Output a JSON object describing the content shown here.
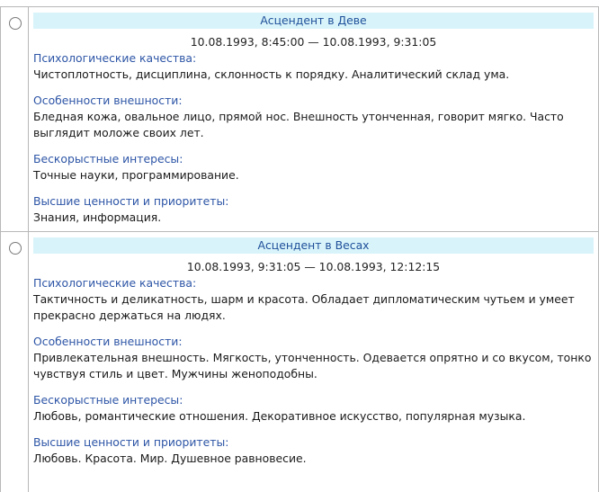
{
  "entries": [
    {
      "title": "Асцендент в Деве",
      "range": "10.08.1993, 8:45:00  —  10.08.1993, 9:31:05",
      "sections": [
        {
          "label": "Психологические качества:",
          "text": "Чистоплотность, дисциплина, склонность к порядку. Аналитический склад ума."
        },
        {
          "label": "Особенности внешности:",
          "text": "Бледная кожа, овальное лицо, прямой нос. Внешность утонченная, говорит мягко. Часто выглядит моложе своих лет."
        },
        {
          "label": "Бескорыстные интересы:",
          "text": "Точные науки, программирование."
        },
        {
          "label": "Высшие ценности и приоритеты:",
          "text": "Знания, информация."
        }
      ]
    },
    {
      "title": "Асцендент в Весах",
      "range": "10.08.1993, 9:31:05  —  10.08.1993, 12:12:15",
      "sections": [
        {
          "label": "Психологические качества:",
          "text": "Тактичность и деликатность, шарм и красота. Обладает дипломатическим чутьем и умеет прекрасно держаться на людях."
        },
        {
          "label": "Особенности внешности:",
          "text": "Привлекательная внешность. Мягкость, утонченность. Одевается опрятно и со вкусом, тонко чувствуя стиль и цвет. Мужчины женоподобны."
        },
        {
          "label": "Бескорыстные интересы:",
          "text": "Любовь, романтические отношения. Декоративное искусство, популярная музыка."
        },
        {
          "label": "Высшие ценности и приоритеты:",
          "text": "Любовь. Красота. Мир. Душевное равновесие."
        }
      ]
    }
  ]
}
